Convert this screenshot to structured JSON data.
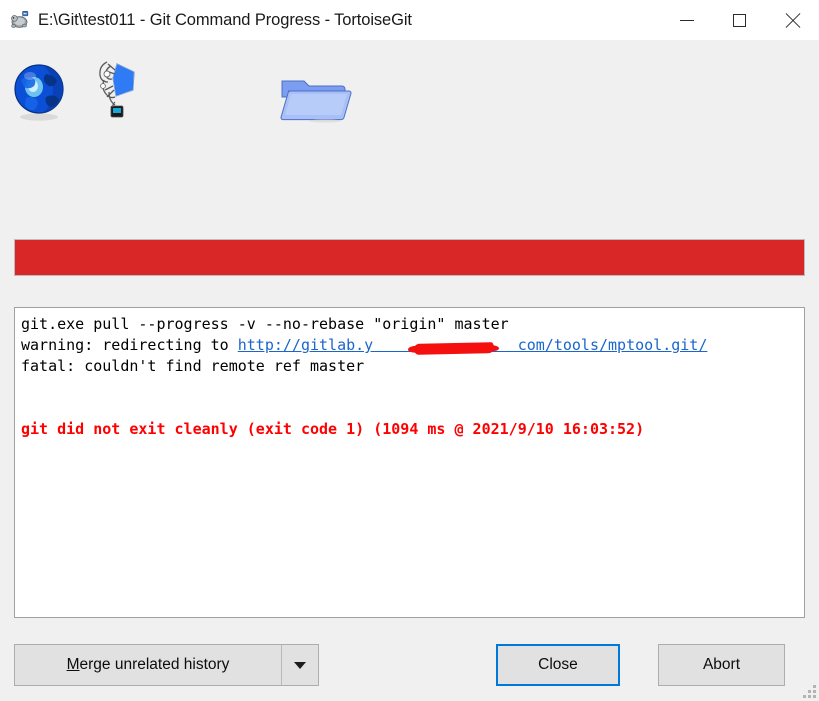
{
  "window": {
    "title": "E:\\Git\\test011 - Git Command Progress - TortoiseGit",
    "icon": "tortoisegit-turtle-icon",
    "titlebar_bg": "#ffffff",
    "body_bg": "#f0f0f0"
  },
  "window_controls": {
    "minimize_label": "Minimize",
    "maximize_label": "Maximize",
    "close_label": "Close"
  },
  "animation_icons": [
    {
      "name": "globe-icon",
      "description": "blue globe"
    },
    {
      "name": "transfer-icon",
      "description": "document transfer animation"
    },
    {
      "name": "folder-icon",
      "description": "open blue folder"
    }
  ],
  "progress": {
    "percent": 100,
    "state": "error",
    "fill_color": "#d92626",
    "track_color": "#e6e6e6"
  },
  "console": {
    "line1": "git.exe pull --progress -v --no-rebase \"origin\" master",
    "line2_prefix": "warning: redirecting to ",
    "line2_url": "http://gitlab.y                com/tools/mptool.git/",
    "line3": "fatal: couldn't find remote ref master",
    "error_line": "git did not exit cleanly (exit code 1) (1094 ms @ 2021/9/10 16:03:52)",
    "link_color": "#1a66cc",
    "error_color": "#ff0000",
    "redaction_color": "#f51010"
  },
  "buttons": {
    "merge_accel": "M",
    "merge_rest": "erge unrelated history",
    "merge_dropdown": "dropdown-arrow",
    "close": "Close",
    "abort": "Abort",
    "default_focus_color": "#0078d7"
  }
}
